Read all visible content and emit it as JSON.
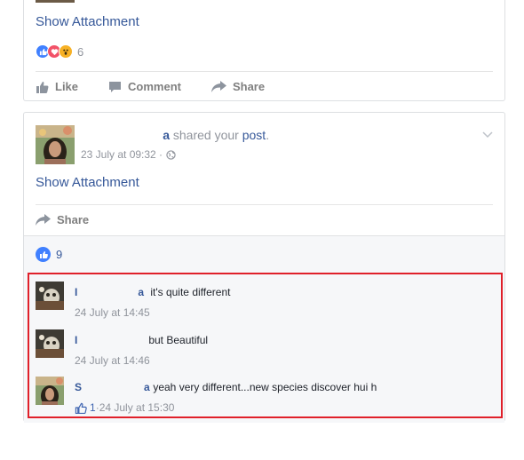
{
  "post1": {
    "show_attachment": "Show Attachment",
    "reaction_count": "6",
    "actions": {
      "like": "Like",
      "comment": "Comment",
      "share": "Share"
    }
  },
  "post2": {
    "actor_visible": "a",
    "shared_text": " shared your ",
    "post_link": "post",
    "period": ".",
    "timestamp": "23 July at 09:32 · ",
    "show_attachment": "Show Attachment",
    "share": "Share",
    "like_count": "9",
    "comments": [
      {
        "name_visible": "a",
        "text": " it's quite different",
        "time": "24 July at 14:45",
        "name_first": "I"
      },
      {
        "name_visible": "",
        "text": " but Beautiful",
        "time": "24 July at 14:46",
        "name_first": "I"
      },
      {
        "name_visible": "a",
        "text": " yeah very different...new species discover hui h",
        "time": "24 July at 15:30",
        "name_first": "S",
        "likes": "1",
        "sep": " · "
      }
    ]
  },
  "colors": {
    "link": "#365899",
    "like_blue": "#4080ff",
    "love": "#f25268",
    "wow": "#f7b125",
    "highlight": "#e0202a"
  },
  "icons": [
    "like-reaction-icon",
    "love-reaction-icon",
    "wow-reaction-icon",
    "thumb-up-icon",
    "comment-icon",
    "share-arrow-icon",
    "globe-icon",
    "chevron-down-icon"
  ]
}
